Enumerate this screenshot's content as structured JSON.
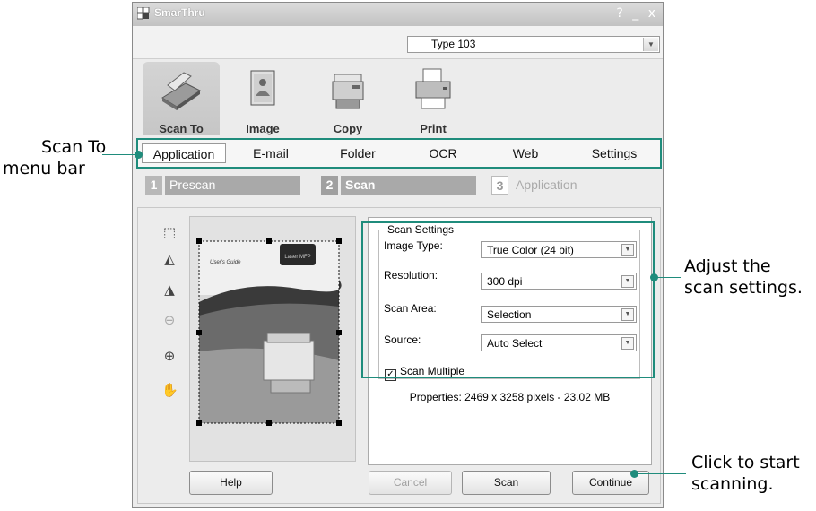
{
  "callouts": {
    "scan_to": "Scan To",
    "menu_bar": "menu bar",
    "adjust_1": "Adjust the",
    "adjust_2": "scan settings.",
    "click_1": "Click to start",
    "click_2": "scanning."
  },
  "window": {
    "title": "SmarThru",
    "controls": [
      "?",
      "_",
      "x"
    ],
    "device": "Type 103"
  },
  "tools": [
    {
      "label": "Scan To",
      "icon": "scanner-icon",
      "active": true
    },
    {
      "label": "Image",
      "icon": "image-icon"
    },
    {
      "label": "Copy",
      "icon": "copier-icon"
    },
    {
      "label": "Print",
      "icon": "printer-icon"
    }
  ],
  "tabs": [
    "Application",
    "E-mail",
    "Folder",
    "OCR",
    "Web",
    "Settings"
  ],
  "steps": [
    {
      "num": "1",
      "label": "Prescan"
    },
    {
      "num": "2",
      "label": "Scan"
    },
    {
      "num": "3",
      "label": "Application"
    }
  ],
  "preview": {
    "doc_title": "User's Guide",
    "doc_badge": "Laser MFP"
  },
  "scan_settings": {
    "legend": "Scan Settings",
    "image_type_label": "Image Type:",
    "image_type": "True Color (24 bit)",
    "resolution_label": "Resolution:",
    "resolution": "300 dpi",
    "scan_area_label": "Scan Area:",
    "scan_area": "Selection",
    "source_label": "Source:",
    "source": "Auto Select",
    "scan_multiple": "Scan Multiple",
    "scan_multiple_checked": true
  },
  "properties": "Properties: 2469 x 3258 pixels - 23.02 MB",
  "buttons": {
    "help": "Help",
    "cancel": "Cancel",
    "scan": "Scan",
    "continue": "Continue"
  },
  "colors": {
    "callout": "#1f8c7c"
  }
}
